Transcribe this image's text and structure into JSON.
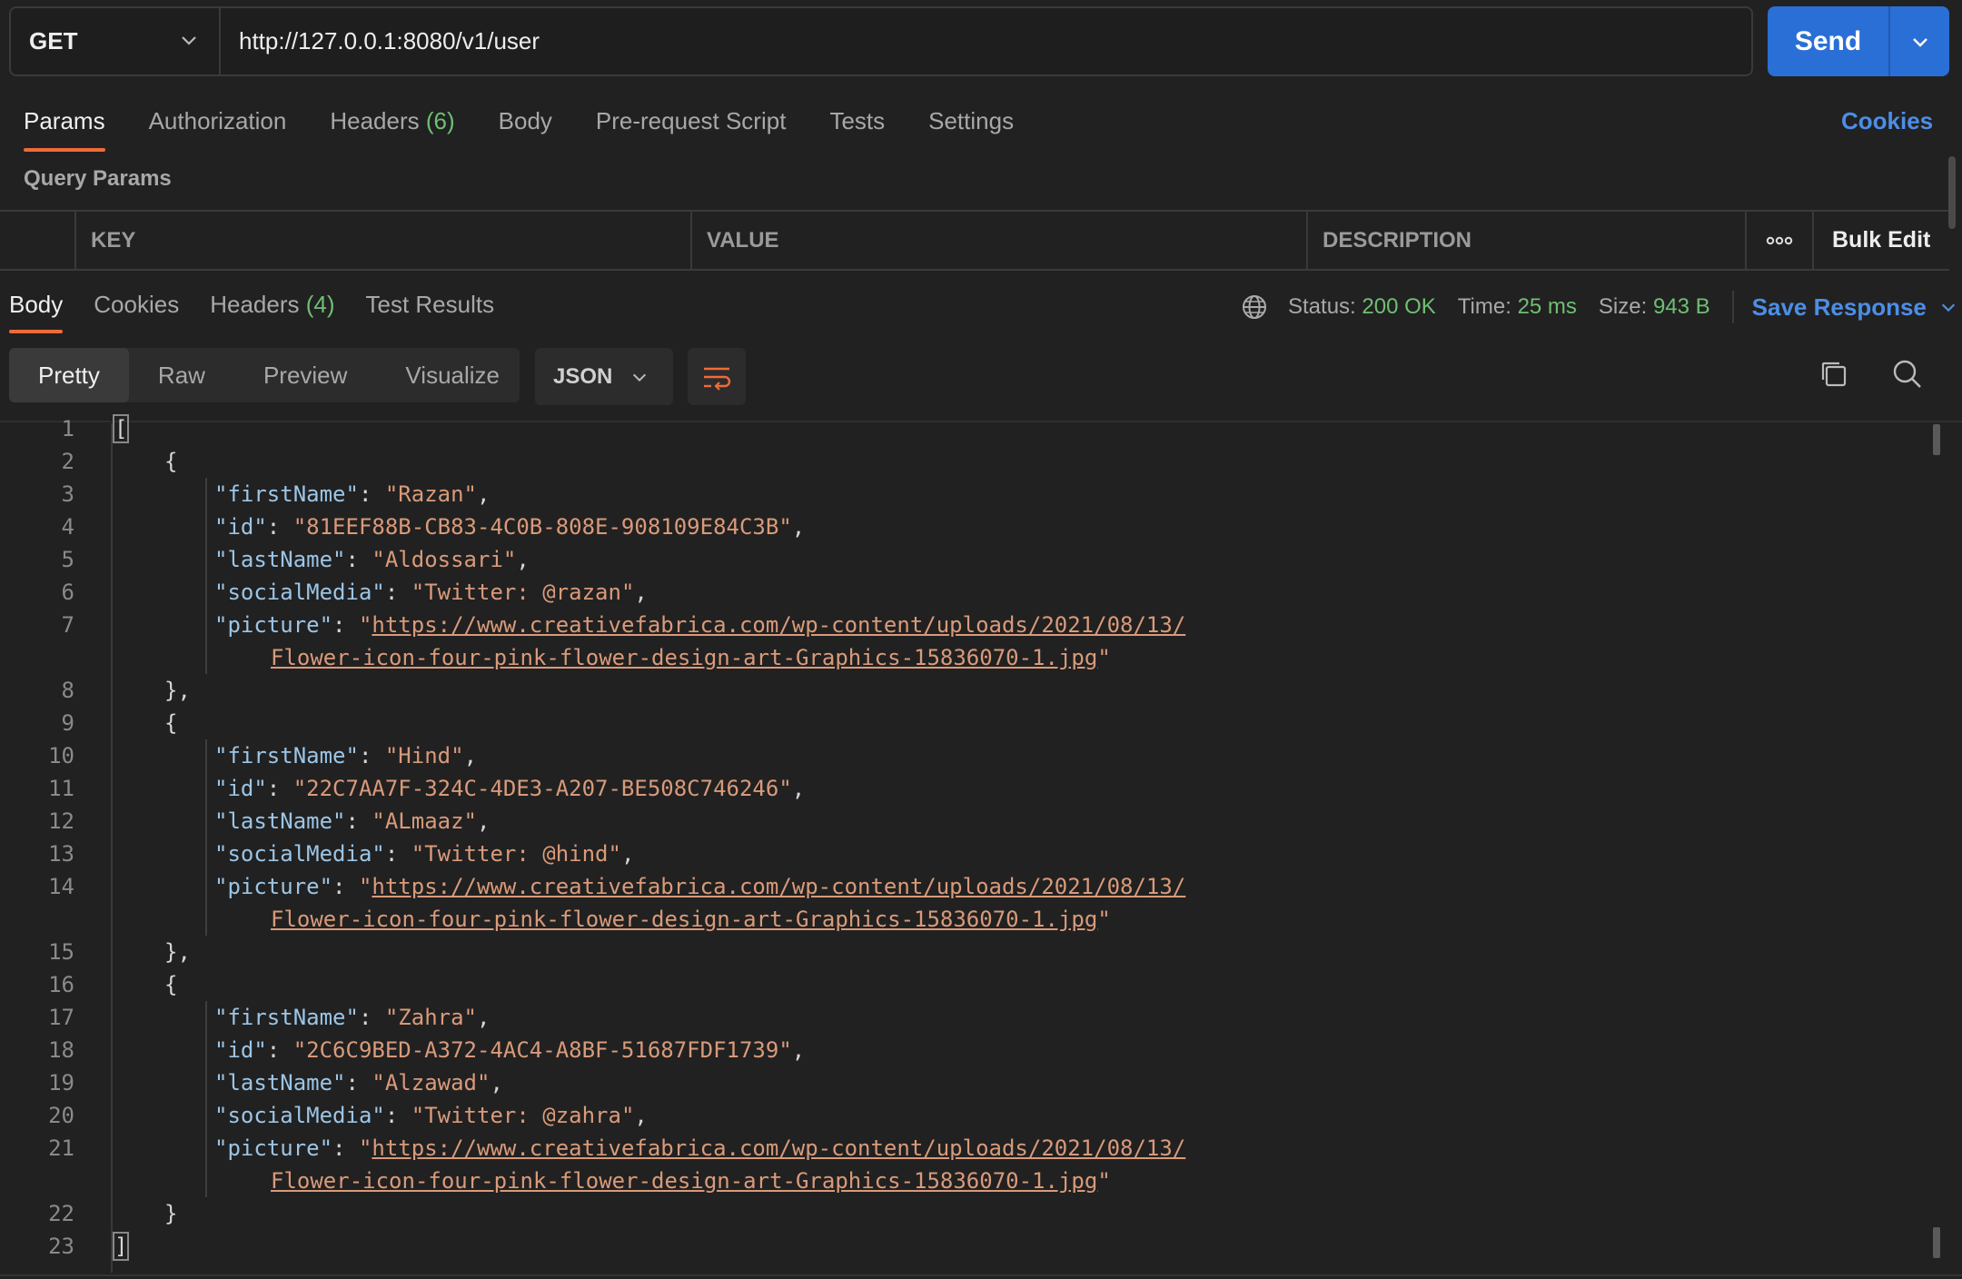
{
  "request": {
    "method": "GET",
    "url": "http://127.0.0.1:8080/v1/user",
    "send_label": "Send"
  },
  "request_tabs": [
    {
      "label": "Params",
      "count": ""
    },
    {
      "label": "Authorization",
      "count": ""
    },
    {
      "label": "Headers",
      "count": "(6)"
    },
    {
      "label": "Body",
      "count": ""
    },
    {
      "label": "Pre-request Script",
      "count": ""
    },
    {
      "label": "Tests",
      "count": ""
    },
    {
      "label": "Settings",
      "count": ""
    }
  ],
  "cookies_link": "Cookies",
  "query_params": {
    "title": "Query Params",
    "columns": [
      "KEY",
      "VALUE",
      "DESCRIPTION"
    ],
    "bulk_edit": "Bulk Edit"
  },
  "response_tabs": [
    {
      "label": "Body",
      "count": ""
    },
    {
      "label": "Cookies",
      "count": ""
    },
    {
      "label": "Headers",
      "count": "(4)"
    },
    {
      "label": "Test Results",
      "count": ""
    }
  ],
  "status": {
    "status_label": "Status:",
    "status_value": "200 OK",
    "time_label": "Time:",
    "time_value": "25 ms",
    "size_label": "Size:",
    "size_value": "943 B",
    "save_response": "Save Response"
  },
  "view_modes": [
    "Pretty",
    "Raw",
    "Preview",
    "Visualize"
  ],
  "format": "JSON",
  "json_body": [
    {
      "ln": "1",
      "text": "[",
      "type": "p",
      "indent": 0
    },
    {
      "ln": "2",
      "text": "{",
      "type": "p",
      "indent": 1
    },
    {
      "ln": "3",
      "key": "firstName",
      "val": "Razan",
      "indent": 2
    },
    {
      "ln": "4",
      "key": "id",
      "val": "81EEF88B-CB83-4C0B-808E-908109E84C3B",
      "indent": 2
    },
    {
      "ln": "5",
      "key": "lastName",
      "val": "Aldossari",
      "indent": 2
    },
    {
      "ln": "6",
      "key": "socialMedia",
      "val": "Twitter: @razan",
      "indent": 2
    },
    {
      "ln": "7",
      "key": "picture",
      "url1": "https://www.creativefabrica.com/wp-content/uploads/2021/08/13/",
      "url2": "Flower-icon-four-pink-flower-design-art-Graphics-15836070-1.jpg",
      "indent": 2
    },
    {
      "ln": "8",
      "text": "},",
      "type": "p",
      "indent": 1
    },
    {
      "ln": "9",
      "text": "{",
      "type": "p",
      "indent": 1
    },
    {
      "ln": "10",
      "key": "firstName",
      "val": "Hind",
      "indent": 2
    },
    {
      "ln": "11",
      "key": "id",
      "val": "22C7AA7F-324C-4DE3-A207-BE508C746246",
      "indent": 2
    },
    {
      "ln": "12",
      "key": "lastName",
      "val": "ALmaaz",
      "indent": 2
    },
    {
      "ln": "13",
      "key": "socialMedia",
      "val": "Twitter: @hind",
      "indent": 2
    },
    {
      "ln": "14",
      "key": "picture",
      "url1": "https://www.creativefabrica.com/wp-content/uploads/2021/08/13/",
      "url2": "Flower-icon-four-pink-flower-design-art-Graphics-15836070-1.jpg",
      "indent": 2
    },
    {
      "ln": "15",
      "text": "},",
      "type": "p",
      "indent": 1
    },
    {
      "ln": "16",
      "text": "{",
      "type": "p",
      "indent": 1
    },
    {
      "ln": "17",
      "key": "firstName",
      "val": "Zahra",
      "indent": 2
    },
    {
      "ln": "18",
      "key": "id",
      "val": "2C6C9BED-A372-4AC4-A8BF-51687FDF1739",
      "indent": 2
    },
    {
      "ln": "19",
      "key": "lastName",
      "val": "Alzawad",
      "indent": 2
    },
    {
      "ln": "20",
      "key": "socialMedia",
      "val": "Twitter: @zahra",
      "indent": 2
    },
    {
      "ln": "21",
      "key": "picture",
      "url1": "https://www.creativefabrica.com/wp-content/uploads/2021/08/13/",
      "url2": "Flower-icon-four-pink-flower-design-art-Graphics-15836070-1.jpg",
      "indent": 2
    },
    {
      "ln": "22",
      "text": "}",
      "type": "p",
      "indent": 1
    },
    {
      "ln": "23",
      "text": "]",
      "type": "p",
      "indent": 0
    }
  ],
  "icons": [
    "chevron-down-icon",
    "more-dots-icon",
    "globe-icon",
    "wrap-lines-icon",
    "copy-icon",
    "search-icon"
  ],
  "colors": {
    "accent_tab": "#ef6b3a",
    "send": "#2a6fd6",
    "link": "#4c8ee8",
    "ok": "#6fbf73",
    "json_key": "#9cc5e6",
    "json_string": "#d99a7a"
  }
}
